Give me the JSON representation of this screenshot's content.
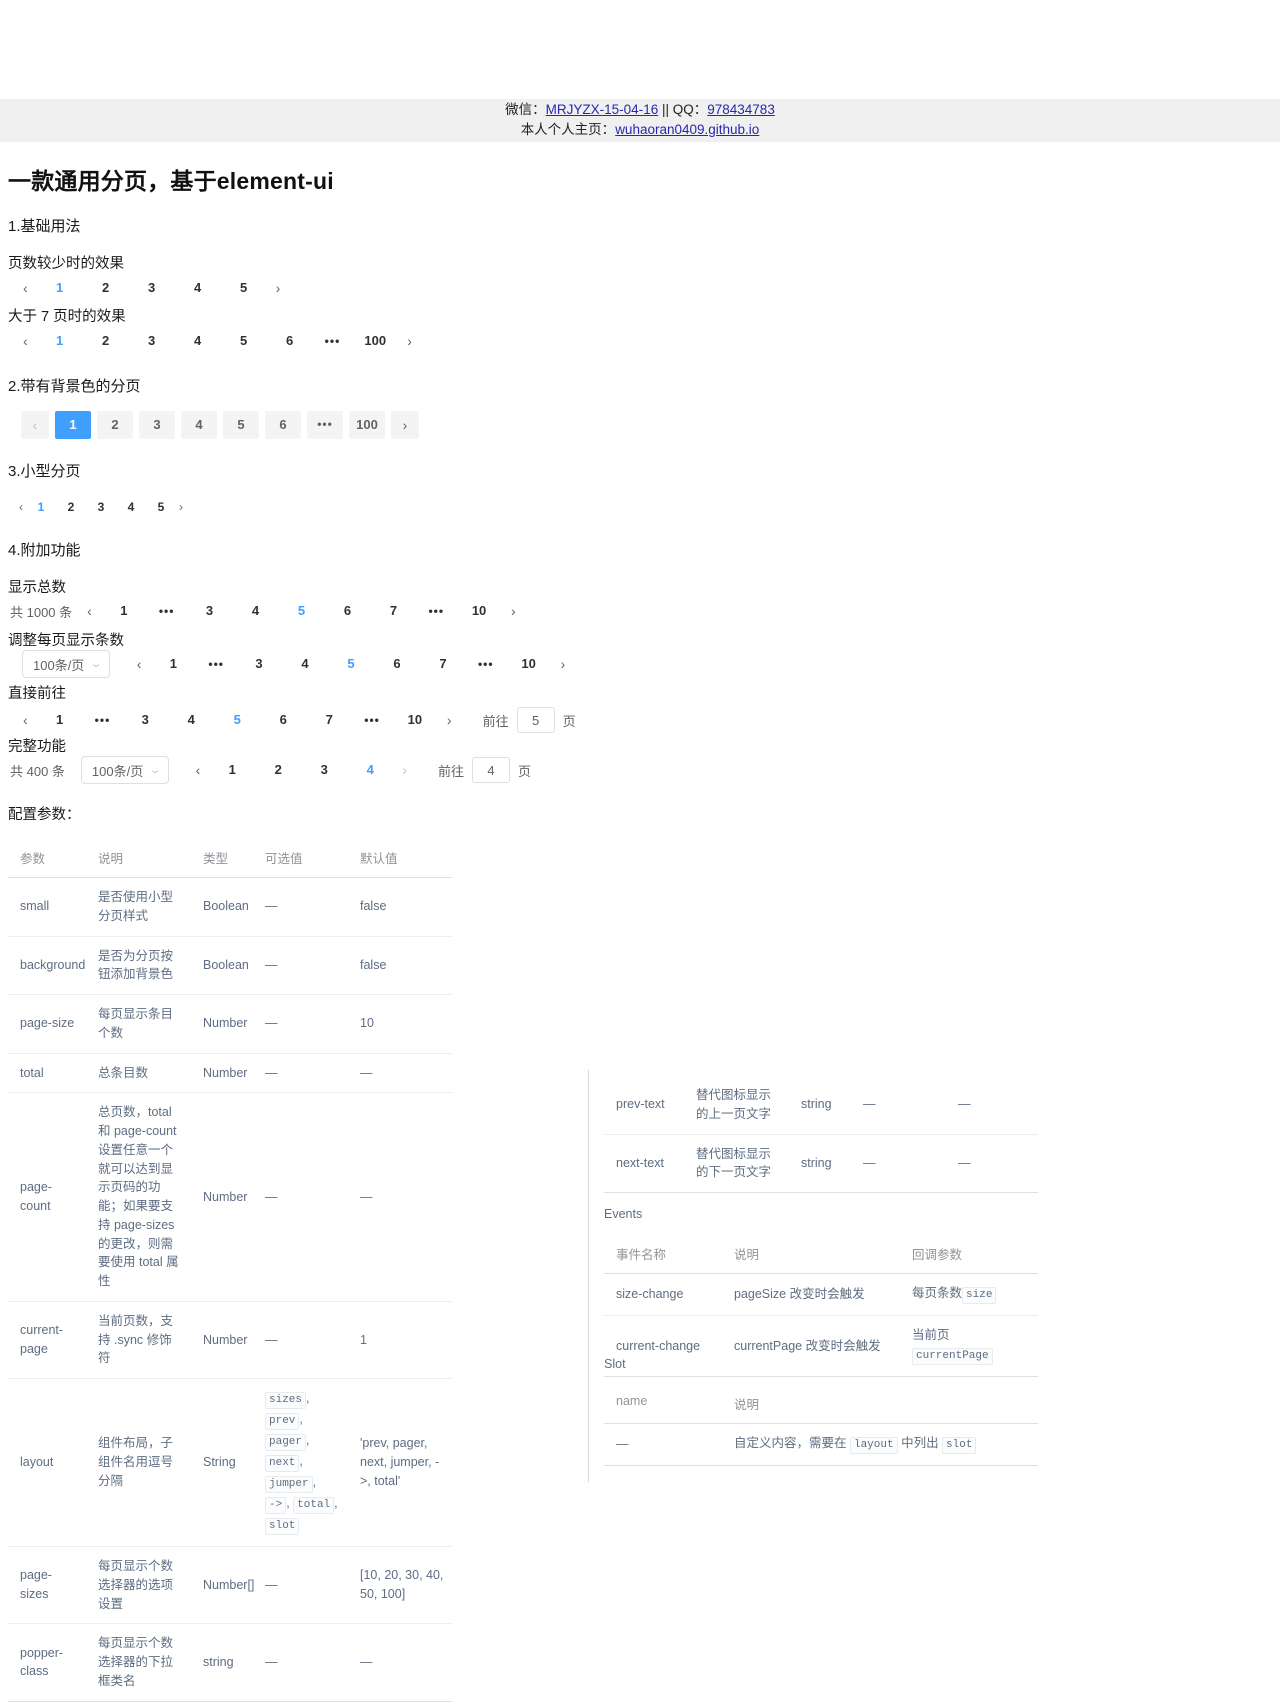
{
  "contact": {
    "wechat_label": "微信：",
    "wechat_value": "MRJYZX-15-04-16",
    "separator": " || ",
    "qq_label": "QQ：",
    "qq_value": "978434783",
    "homepage_label": "本人个人主页：",
    "homepage_value": "wuhaoran0409.github.io"
  },
  "page_title": "一款通用分页，基于element-ui",
  "sections": {
    "s1": "1.基础用法",
    "s1_sub1": "页数较少时的效果",
    "s1_sub2": "大于 7 页时的效果",
    "s2": "2.带有背景色的分页",
    "s3": "3.小型分页",
    "s4": "4.附加功能",
    "s4_sub1": "显示总数",
    "s4_sub2": "调整每页显示条数",
    "s4_sub3": "直接前往",
    "s4_sub4": "完整功能",
    "config_title": "配置参数："
  },
  "icons": {
    "prev": "‹",
    "next": "›",
    "dots": "•••",
    "caret_down": "⌄"
  },
  "pagers": {
    "basic_few": {
      "pages": [
        "1",
        "2",
        "3",
        "4",
        "5"
      ],
      "active": "1"
    },
    "basic_many": {
      "pages": [
        "1",
        "2",
        "3",
        "4",
        "5",
        "6"
      ],
      "dots": "•••",
      "last": "100",
      "active": "1"
    },
    "background": {
      "pages": [
        "1",
        "2",
        "3",
        "4",
        "5",
        "6"
      ],
      "dots": "•••",
      "last": "100",
      "active": "1"
    },
    "small": {
      "pages": [
        "1",
        "2",
        "3",
        "4",
        "5"
      ],
      "active": "1"
    },
    "total": {
      "total_text": "共 1000 条",
      "first": "1",
      "dots_left": "•••",
      "pages": [
        "3",
        "4",
        "5",
        "6",
        "7"
      ],
      "dots_right": "•••",
      "last": "10",
      "active": "5"
    },
    "sizes": {
      "select_value": "100条/页",
      "first": "1",
      "dots_left": "•••",
      "pages": [
        "3",
        "4",
        "5",
        "6",
        "7"
      ],
      "dots_right": "•••",
      "last": "10",
      "active": "5"
    },
    "jumper": {
      "first": "1",
      "dots_left": "•••",
      "pages": [
        "3",
        "4",
        "5",
        "6",
        "7"
      ],
      "dots_right": "•••",
      "last": "10",
      "active": "5",
      "goto_label": "前往",
      "goto_value": "5",
      "page_unit": "页"
    },
    "full": {
      "total_text": "共 400 条",
      "select_value": "100条/页",
      "pages": [
        "1",
        "2",
        "3",
        "4"
      ],
      "active": "4",
      "goto_label": "前往",
      "goto_value": "4",
      "page_unit": "页"
    }
  },
  "attr_table": {
    "headers": [
      "参数",
      "说明",
      "类型",
      "可选值",
      "默认值"
    ],
    "rows": [
      {
        "name": "small",
        "desc": "是否使用小型分页样式",
        "type": "Boolean",
        "options": "—",
        "default": "false"
      },
      {
        "name": "background",
        "desc": "是否为分页按钮添加背景色",
        "type": "Boolean",
        "options": "—",
        "default": "false"
      },
      {
        "name": "page-size",
        "desc": "每页显示条目个数",
        "type": "Number",
        "options": "—",
        "default": "10"
      },
      {
        "name": "total",
        "desc": "总条目数",
        "type": "Number",
        "options": "—",
        "default": "—"
      },
      {
        "name": "page-count",
        "desc": "总页数，total 和 page-count 设置任意一个就可以达到显示页码的功能；如果要支持 page-sizes 的更改，则需要使用 total 属性",
        "type": "Number",
        "options": "—",
        "default": "—"
      },
      {
        "name": "current-page",
        "desc": "当前页数，支持 .sync 修饰符",
        "type": "Number",
        "options": "—",
        "default": "1"
      },
      {
        "name": "layout",
        "desc": "组件布局，子组件名用逗号分隔",
        "type": "String",
        "options_chips": [
          "sizes",
          "prev",
          "pager",
          "next",
          "jumper",
          "->",
          "total",
          "slot"
        ],
        "default": "'prev, pager, next, jumper, ->, total'"
      },
      {
        "name": "page-sizes",
        "desc": "每页显示个数选择器的选项设置",
        "type": "Number[]",
        "options": "—",
        "default": "[10, 20, 30, 40, 50, 100]"
      },
      {
        "name": "popper-class",
        "desc": "每页显示个数选择器的下拉框类名",
        "type": "string",
        "options": "—",
        "default": "—"
      }
    ]
  },
  "attr_table_right": {
    "rows": [
      {
        "name": "prev-text",
        "desc": "替代图标显示的上一页文字",
        "type": "string",
        "options": "—",
        "default": "—"
      },
      {
        "name": "next-text",
        "desc": "替代图标显示的下一页文字",
        "type": "string",
        "options": "—",
        "default": "—"
      }
    ]
  },
  "events": {
    "title": "Events",
    "headers": [
      "事件名称",
      "说明",
      "回调参数"
    ],
    "rows": [
      {
        "name": "size-change",
        "desc": "pageSize 改变时会触发",
        "param_text": "每页条数",
        "param_code": "size"
      },
      {
        "name": "current-change",
        "desc": "currentPage 改变时会触发",
        "param_text": "当前页",
        "param_code": "currentPage"
      }
    ]
  },
  "slot": {
    "title": "Slot",
    "headers": [
      "name",
      "说明"
    ],
    "row": {
      "name": "—",
      "desc_a": "自定义内容，需要在 ",
      "desc_code1": "layout",
      "desc_b": " 中列出 ",
      "desc_code2": "slot"
    }
  },
  "colors": {
    "accent": "#409EFF",
    "link": "#2727b0",
    "bar_bg": "#f0f0f0",
    "btn_bg": "#f4f4f5"
  }
}
